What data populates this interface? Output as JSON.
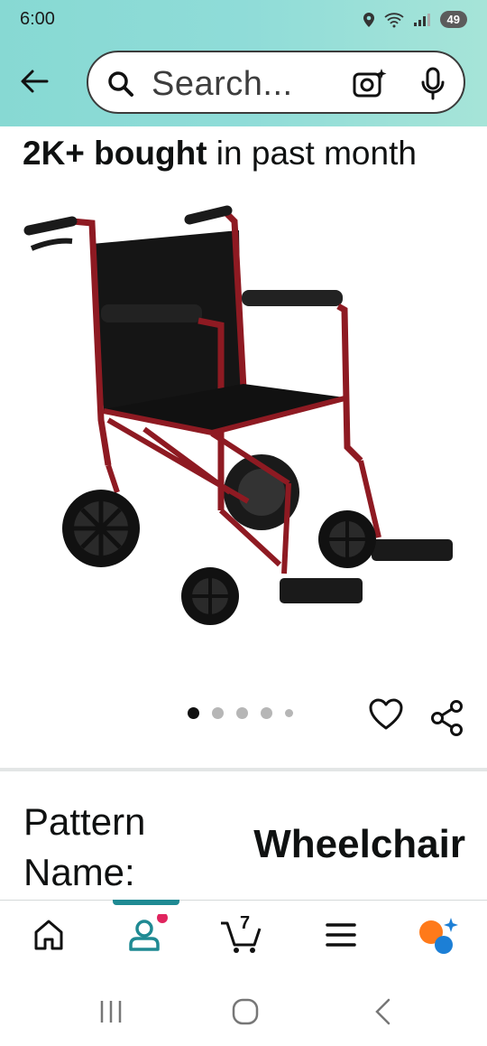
{
  "status_bar": {
    "time": "6:00",
    "battery": "49"
  },
  "search": {
    "placeholder": "Search..."
  },
  "product": {
    "bought_bold": "2K+ bought",
    "bought_rest": " in past month",
    "image_count": 5,
    "active_image": 0,
    "pattern_label": "Pattern Name:",
    "pattern_value": "Wheelchair"
  },
  "bottom_nav": {
    "cart_count": "7"
  },
  "colors": {
    "header_bg": "#8fdcd8",
    "accent": "#1f8a93",
    "notification": "#e0245e",
    "frame": "#8e1a22"
  }
}
